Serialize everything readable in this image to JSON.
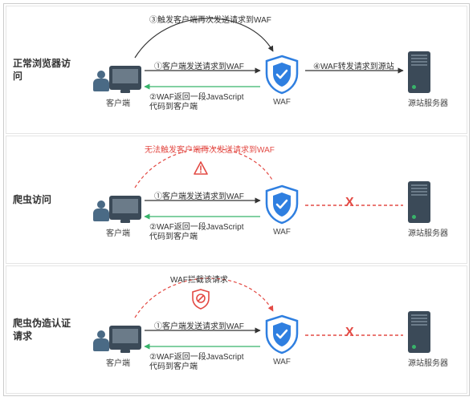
{
  "panels": {
    "normal": {
      "title": "正常浏览器访问"
    },
    "crawler": {
      "title": "爬虫访问"
    },
    "forged": {
      "title": "爬虫伪造认证请求"
    }
  },
  "nodes": {
    "client": "客户端",
    "waf": "WAF",
    "server": "源站服务器"
  },
  "labels": {
    "step1": "①客户端发送请求到WAF",
    "step2_line1": "②WAF返回一段JavaScript",
    "step2_line2": "代码到客户端",
    "step3": "③触发客户端再次发送请求到WAF",
    "step4": "④WAF转发请求到源站",
    "crawler_fail": "无法触发客户端再次发送请求到WAF",
    "intercepted": "WAF拦截该请求",
    "block_mark": "X"
  },
  "colors": {
    "black": "#333333",
    "green": "#38b36a",
    "blue": "#2f7fe0",
    "red": "#e34b45"
  }
}
